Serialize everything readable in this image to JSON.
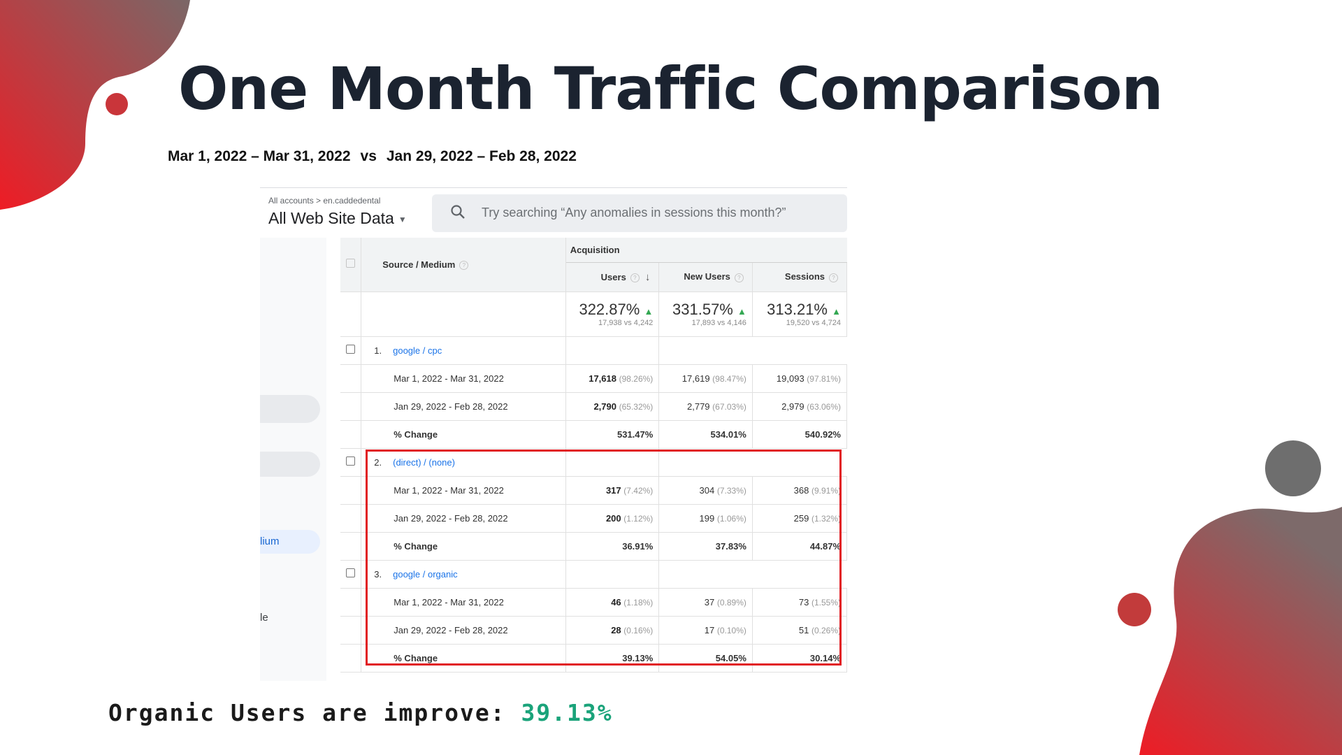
{
  "slide": {
    "title": "One Month Traffic Comparison",
    "date_range_a": "Mar 1, 2022 – Mar 31, 2022",
    "vs": "vs",
    "date_range_b": "Jan 29, 2022 – Feb 28, 2022",
    "footer_label": "Organic Users are improve:",
    "footer_value": "39.13%",
    "colors": {
      "accent_red": "#e11b22",
      "positive_green": "#1aa37a",
      "title_dark": "#1b2330"
    }
  },
  "analytics": {
    "breadcrumb": "All accounts > en.caddedental",
    "view_selector": "All Web Site Data",
    "search": {
      "icon": "search-icon",
      "placeholder": "Try searching “Any anomalies in sessions this month?”"
    },
    "sidebar_fragments": {
      "medium": "lium",
      "le": "le"
    },
    "header": {
      "dimension": "Source / Medium",
      "group": "Acquisition",
      "metrics": [
        "Users",
        "New Users",
        "Sessions"
      ]
    },
    "totals": [
      {
        "change": "322.87%",
        "detail": "17,938 vs 4,242"
      },
      {
        "change": "331.57%",
        "detail": "17,893 vs 4,146"
      },
      {
        "change": "313.21%",
        "detail": "19,520 vs 4,724"
      }
    ],
    "rows": [
      {
        "index": "1.",
        "source": "google / cpc",
        "period_a": {
          "label": "Mar 1, 2022 - Mar 31, 2022",
          "users": "17,618",
          "users_pct": "(98.26%)",
          "new_users": "17,619",
          "new_users_pct": "(98.47%)",
          "sessions": "19,093",
          "sessions_pct": "(97.81%)"
        },
        "period_b": {
          "label": "Jan 29, 2022 - Feb 28, 2022",
          "users": "2,790",
          "users_pct": "(65.32%)",
          "new_users": "2,779",
          "new_users_pct": "(67.03%)",
          "sessions": "2,979",
          "sessions_pct": "(63.06%)"
        },
        "change": {
          "label": "% Change",
          "users": "531.47%",
          "new_users": "534.01%",
          "sessions": "540.92%"
        }
      },
      {
        "index": "2.",
        "source": "(direct) / (none)",
        "period_a": {
          "label": "Mar 1, 2022 - Mar 31, 2022",
          "users": "317",
          "users_pct": "(7.42%)",
          "new_users": "304",
          "new_users_pct": "(7.33%)",
          "sessions": "368",
          "sessions_pct": "(9.91%)"
        },
        "period_b": {
          "label": "Jan 29, 2022 - Feb 28, 2022",
          "users": "200",
          "users_pct": "(1.12%)",
          "new_users": "199",
          "new_users_pct": "(1.06%)",
          "sessions": "259",
          "sessions_pct": "(1.32%)"
        },
        "change": {
          "label": "% Change",
          "users": "36.91%",
          "new_users": "37.83%",
          "sessions": "44.87%"
        }
      },
      {
        "index": "3.",
        "source": "google / organic",
        "period_a": {
          "label": "Mar 1, 2022 - Mar 31, 2022",
          "users": "46",
          "users_pct": "(1.18%)",
          "new_users": "37",
          "new_users_pct": "(0.89%)",
          "sessions": "73",
          "sessions_pct": "(1.55%)"
        },
        "period_b": {
          "label": "Jan 29, 2022 - Feb 28, 2022",
          "users": "28",
          "users_pct": "(0.16%)",
          "new_users": "17",
          "new_users_pct": "(0.10%)",
          "sessions": "51",
          "sessions_pct": "(0.26%)"
        },
        "change": {
          "label": "% Change",
          "users": "39.13%",
          "new_users": "54.05%",
          "sessions": "30.14%"
        }
      }
    ]
  }
}
